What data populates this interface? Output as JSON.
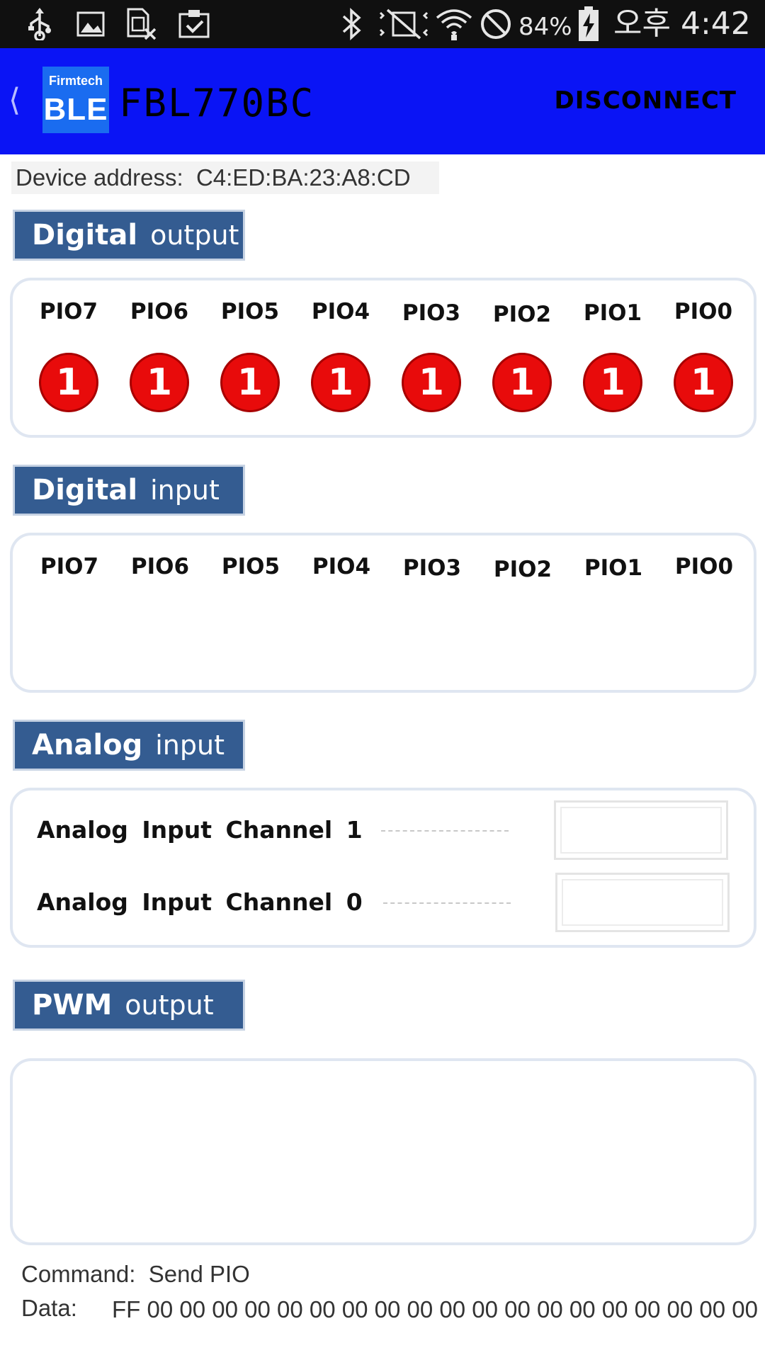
{
  "status_bar": {
    "icons_left": [
      "usb-icon",
      "image-icon",
      "sim-icon",
      "clipboard-check-icon"
    ],
    "icons_right": [
      "bluetooth-icon",
      "vibrate-mute-icon",
      "wifi-icon",
      "blocked-icon"
    ],
    "battery_percent": "84%",
    "time": "오후 4:42"
  },
  "app_bar": {
    "logo_top": "Firmtech",
    "logo_main": "BLE",
    "device_name": "FBL770BC",
    "disconnect_label": "DISCONNECT"
  },
  "device_address": {
    "label": "Device address:",
    "value": "C4:ED:BA:23:A8:CD"
  },
  "digital_output": {
    "header_strong": "Digital",
    "header_light": "output",
    "pins": [
      "PIO7",
      "PIO6",
      "PIO5",
      "PIO4",
      "PIO3",
      "PIO2",
      "PIO1",
      "PIO0"
    ],
    "values": [
      "1",
      "1",
      "1",
      "1",
      "1",
      "1",
      "1",
      "1"
    ],
    "button_color": "#e80b0b"
  },
  "digital_input": {
    "header_strong": "Digital",
    "header_light": "input",
    "pins": [
      "PIO7",
      "PIO6",
      "PIO5",
      "PIO4",
      "PIO3",
      "PIO2",
      "PIO1",
      "PIO0"
    ]
  },
  "analog_input": {
    "header_strong": "Analog",
    "header_light": "input",
    "channels": [
      {
        "label": "Analog Input Channel 1",
        "value": ""
      },
      {
        "label": "Analog Input Channel 0",
        "value": ""
      }
    ]
  },
  "pwm_output": {
    "header_strong": "PWM",
    "header_light": "output"
  },
  "footer": {
    "command_label": "Command:",
    "command_value": "Send PIO",
    "data_label": "Data:",
    "data_value": "FF 00 00 00 00 00 00 00 00 00 00 00 00 00 00 00 00 00 00 00"
  },
  "colors": {
    "app_bar": "#0a14f5",
    "section_header": "#345c91",
    "status_bar": "#101010"
  }
}
